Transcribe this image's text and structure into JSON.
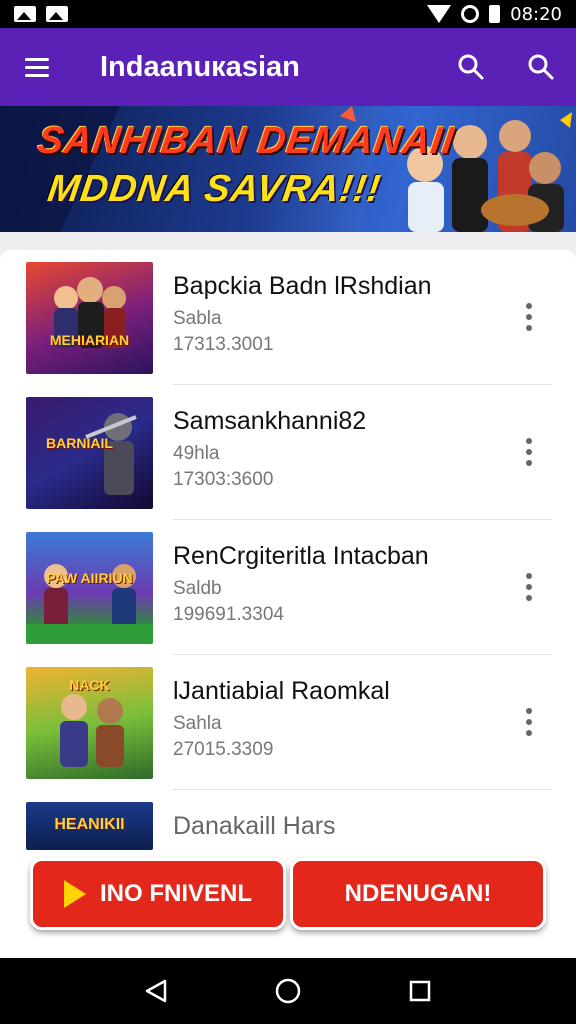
{
  "status": {
    "time": "08:20"
  },
  "app": {
    "title": "Indaanuкasian",
    "colors": {
      "primary": "#5b21b6",
      "accent": "#e3271b"
    },
    "icons": [
      "menu-icon",
      "search-icon",
      "search-icon"
    ]
  },
  "banner": {
    "line1": "SANНIBAN DEMANAII",
    "line2": "MDDNA SAVRA!!!"
  },
  "list": {
    "items": [
      {
        "title": "Baрckia Badn lRshdian",
        "subtitle": "Sabla",
        "meta": "17313.3001",
        "thumb_text": "MEHIARIAN"
      },
      {
        "title": "Samsankhanni82",
        "subtitle": "49hla",
        "meta": "17303:3600",
        "thumb_text": "BARNIAIL"
      },
      {
        "title": "RenCrgiteritla Intacban",
        "subtitle": "Saldb",
        "meta": "199691.3304",
        "thumb_text": "PAW AIIRIUN"
      },
      {
        "title": "lJantiabial Raomkal",
        "subtitle": "Sahla",
        "meta": "27015.3309",
        "thumb_text": "NACK"
      },
      {
        "title": "Danakaill Hars",
        "subtitle": "",
        "meta": "",
        "thumb_text": "HEANIKII"
      }
    ]
  },
  "buttons": {
    "left_label": "INO FNIVENL",
    "right_label": "NDENUGAN!"
  }
}
